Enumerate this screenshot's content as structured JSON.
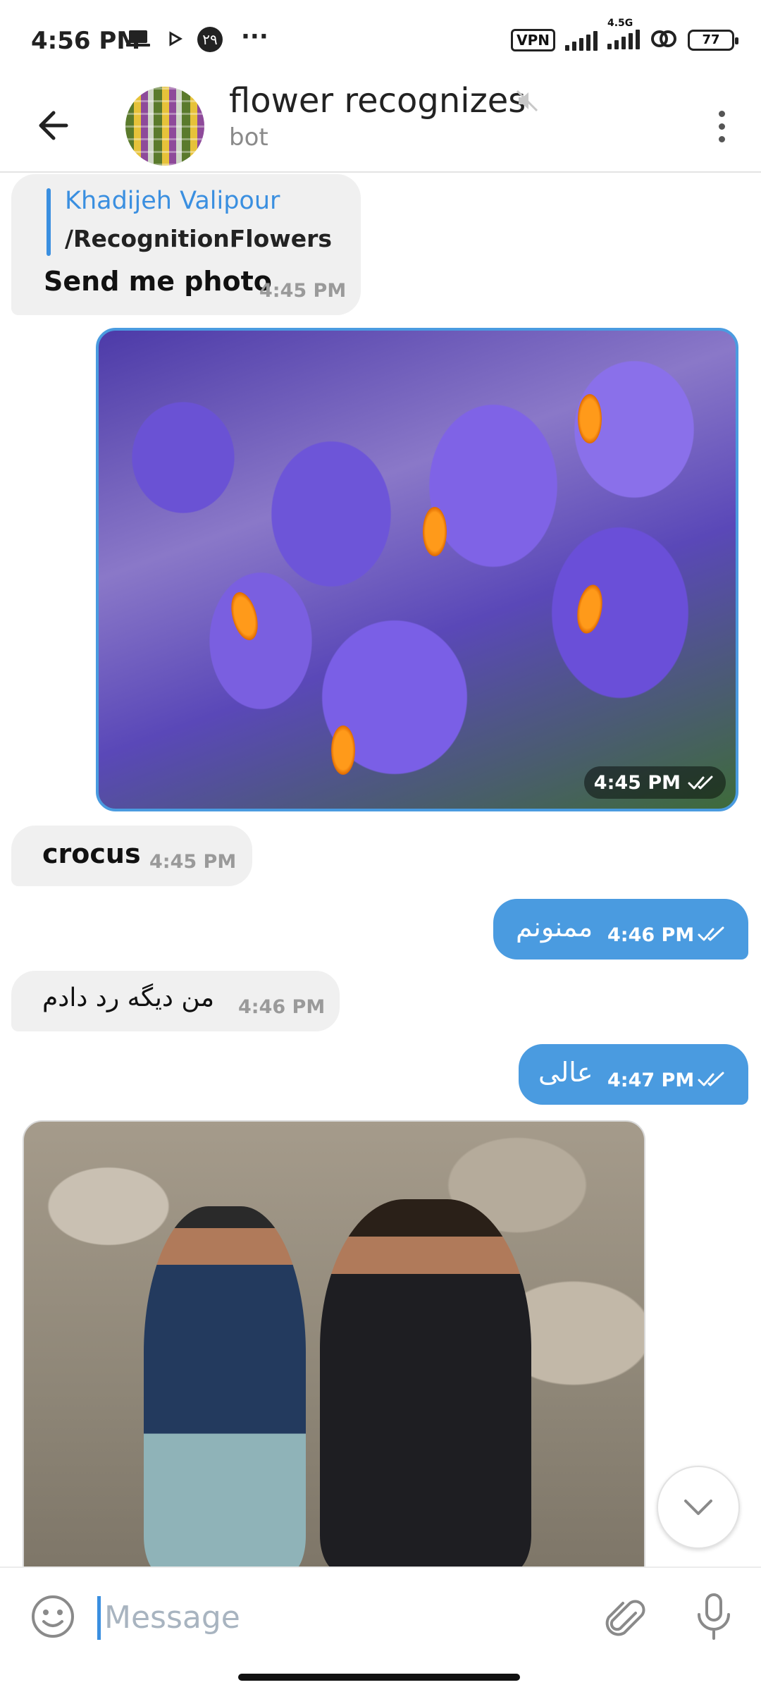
{
  "status_bar": {
    "time": "4:56 PM",
    "notification_digit": "۲۹",
    "more": "···",
    "vpn": "VPN",
    "network": "4.5G",
    "battery": "77"
  },
  "header": {
    "title": "flower recognizes",
    "subtitle": "bot"
  },
  "messages": {
    "m1": {
      "reply_name": "Khadijeh Valipour",
      "reply_text": "/RecognitionFlowers",
      "text": "Send me photo",
      "time": "4:45 PM"
    },
    "m2": {
      "time": "4:45 PM"
    },
    "m3": {
      "text": "crocus",
      "time": "4:45 PM"
    },
    "m4": {
      "text": "ممنونم",
      "time": "4:46 PM"
    },
    "m5": {
      "text": "من دیگه رد دادم",
      "time": "4:46 PM"
    },
    "m6": {
      "text": "عالی",
      "time": "4:47 PM"
    }
  },
  "composer": {
    "placeholder": "Message"
  },
  "colors": {
    "accent": "#4a9be0",
    "incoming_bubble": "#f0f0f0"
  }
}
